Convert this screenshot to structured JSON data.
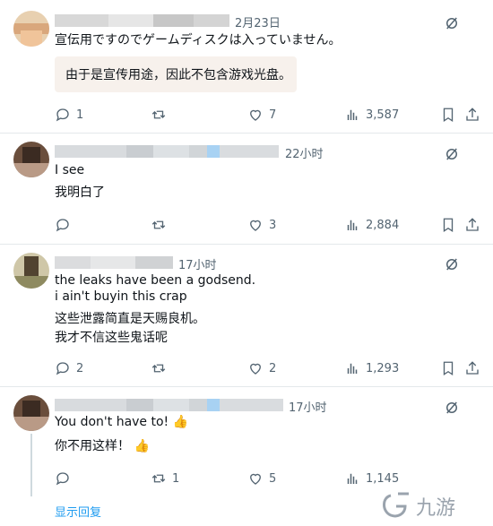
{
  "tweets": [
    {
      "time": "2月23日",
      "lines": [
        "宣伝用ですのでゲームディスクは入っていません。"
      ],
      "translation_box": "由于是宣传用途，因此不包含游戏光盘。",
      "reply_count": "1",
      "like_count": "7",
      "view_count": "3,587"
    },
    {
      "time": "22小时",
      "lines": [
        "I see",
        "我明白了"
      ],
      "reply_count": "",
      "like_count": "3",
      "view_count": "2,884"
    },
    {
      "time": "17小时",
      "lines": [
        "the leaks have been a godsend.",
        "i ain't buyin this crap",
        "这些泄露简直是天赐良机。",
        "我才不信这些鬼话呢"
      ],
      "reply_count": "2",
      "like_count": "2",
      "view_count": "1,293"
    },
    {
      "time": "17小时",
      "lines": [
        "You don't have to! 👍",
        "你不用这样！ 👍"
      ],
      "reply_count": "",
      "retweet_count": "1",
      "like_count": "5",
      "view_count": "1,145"
    }
  ],
  "show_replies": "显示回复",
  "watermark": "九游",
  "colors": {
    "link": "#1d9bf0",
    "muted": "#536471"
  }
}
